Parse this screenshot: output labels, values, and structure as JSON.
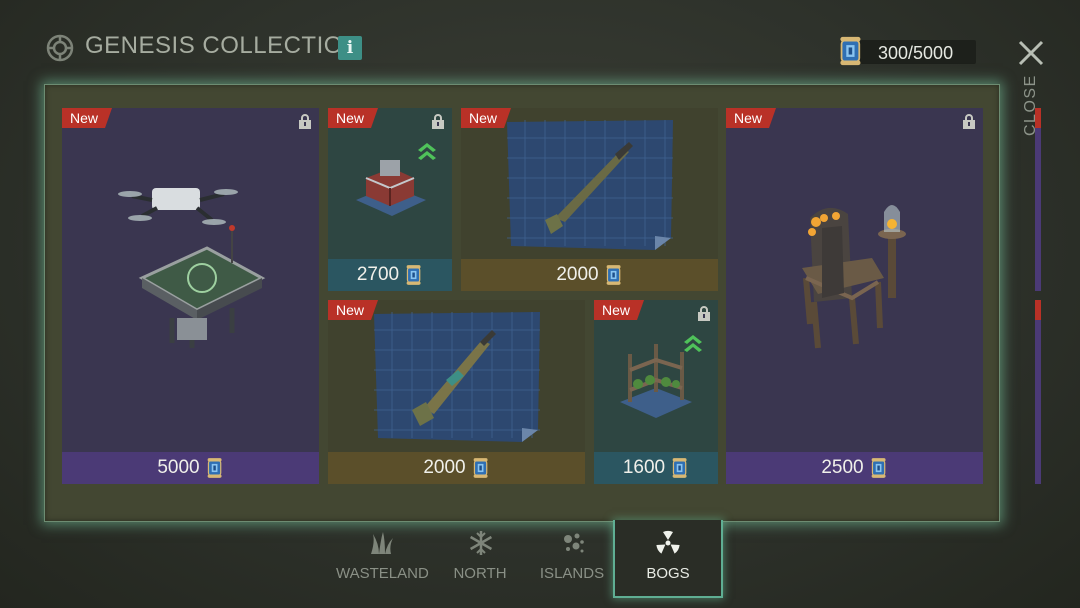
{
  "header": {
    "title": "GENESIS COLLECTION",
    "info_label": "i",
    "currency_value": "300/5000",
    "close_label": "CLOSE"
  },
  "cards": [
    {
      "badge": "New",
      "price": "5000",
      "locked": true,
      "theme": "purple",
      "item": "drone-landing-pad"
    },
    {
      "badge": "New",
      "price": "2700",
      "locked": true,
      "upgrade": true,
      "theme": "teal",
      "item": "workbench"
    },
    {
      "badge": "New",
      "price": "2000",
      "locked": false,
      "theme": "olive",
      "item": "shotgun-blueprint"
    },
    {
      "badge": "New",
      "price": "2500",
      "locked": true,
      "theme": "purple",
      "item": "throne-chair"
    },
    {
      "badge": "New",
      "price": "2000",
      "locked": false,
      "theme": "olive",
      "item": "rifle-blueprint"
    },
    {
      "badge": "New",
      "price": "1600",
      "locked": true,
      "upgrade": true,
      "theme": "teal",
      "item": "planter-shelf"
    }
  ],
  "tabs": [
    {
      "label": "WASTELAND",
      "icon": "grass-icon",
      "active": false
    },
    {
      "label": "NORTH",
      "icon": "snowflake-icon",
      "active": false
    },
    {
      "label": "ISLANDS",
      "icon": "islands-icon",
      "active": false
    },
    {
      "label": "BOGS",
      "icon": "radiation-icon",
      "active": true
    }
  ],
  "colors": {
    "accent": "#5fae93",
    "badge": "#b93127",
    "purple": "#4b3a76",
    "teal": "#2b5661",
    "olive": "#5b4f2a"
  }
}
